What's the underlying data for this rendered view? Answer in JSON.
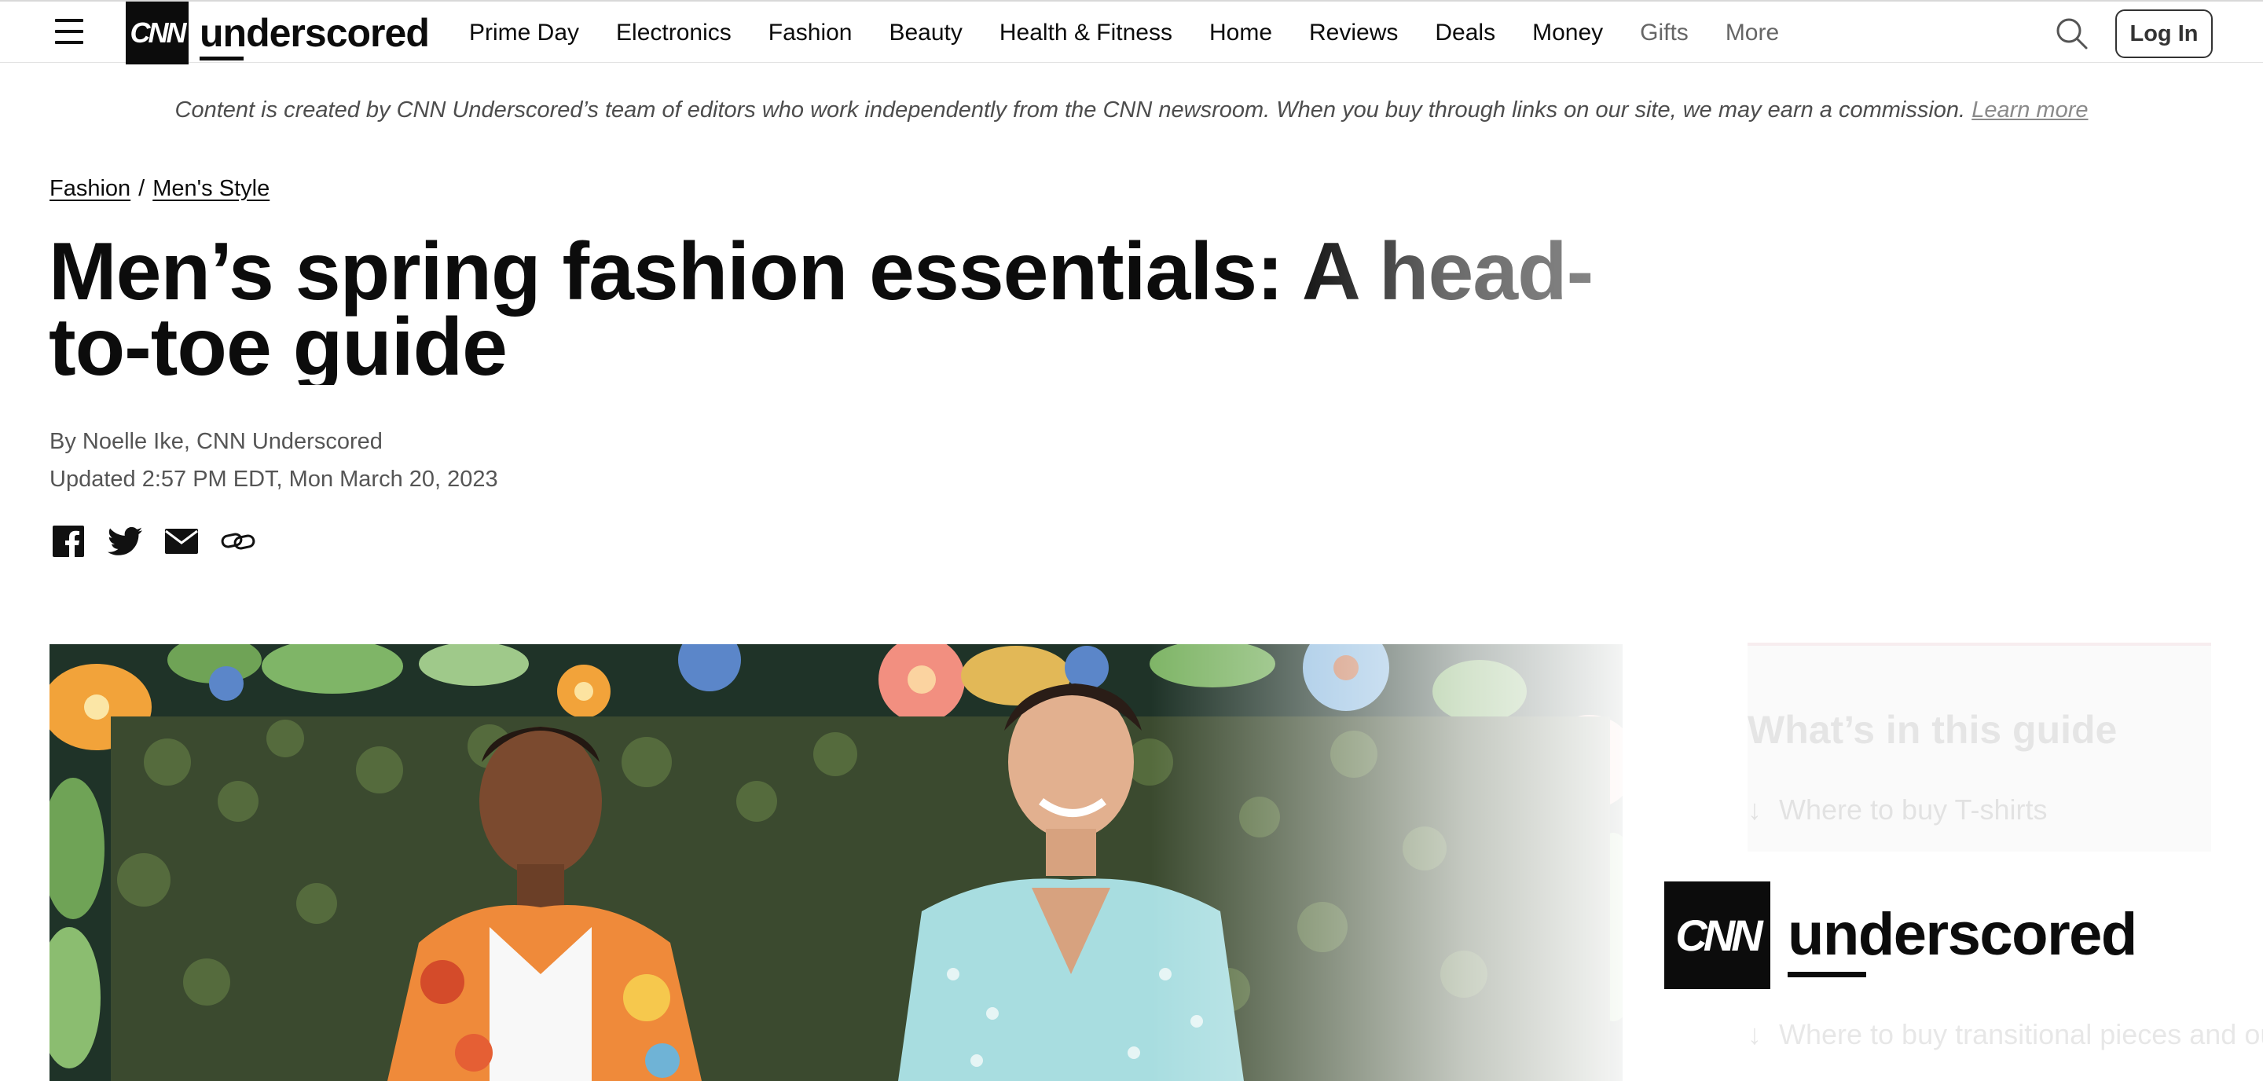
{
  "nav": {
    "brand_mark": "CNN",
    "brand_word": "underscored",
    "links": [
      "Prime Day",
      "Electronics",
      "Fashion",
      "Beauty",
      "Health & Fitness",
      "Home",
      "Reviews",
      "Deals",
      "Money",
      "Gifts",
      "More"
    ],
    "login_label": "Log In"
  },
  "disclaimer": {
    "text": "Content is created by CNN Underscored’s team of editors who work independently from the CNN newsroom. When you buy through links on our site, we may earn a commission.",
    "link": "Learn more"
  },
  "breadcrumb": {
    "items": [
      "Fashion",
      "Men's Style"
    ],
    "separator": "/"
  },
  "article": {
    "headline": "Men’s spring fashion essentials: A head-to-toe guide",
    "byline": "By Noelle Ike, CNN Underscored",
    "updated": "Updated 2:57 PM EDT, Mon March 20, 2023"
  },
  "share_icons": [
    "facebook-icon",
    "twitter-icon",
    "email-icon",
    "link-icon"
  ],
  "sidebar": {
    "toc_title": "What’s in this guide",
    "toc_items": [
      "Where to buy T-shirts",
      "Where to buy transitional pieces and outerwear"
    ],
    "logo_mark": "CNN",
    "logo_word": "underscored"
  },
  "colors": {
    "text": "#0c0c0c",
    "muted": "#555555",
    "accent": "#0c0c0c"
  }
}
